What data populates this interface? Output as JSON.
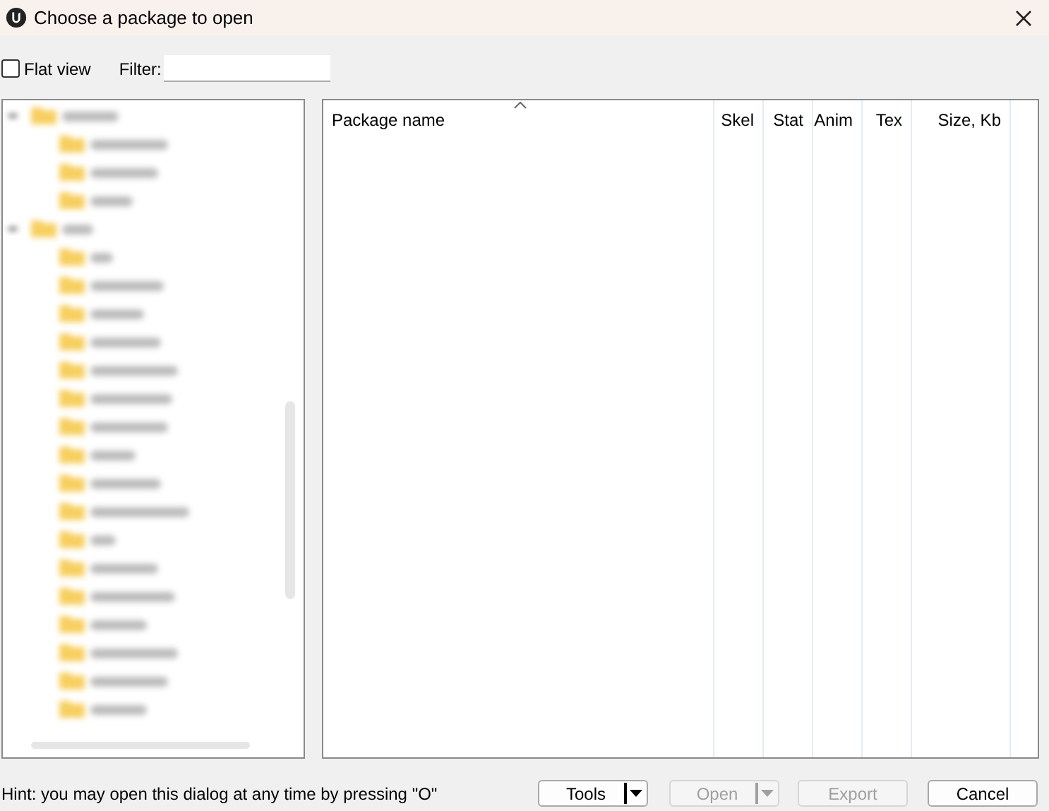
{
  "window": {
    "title": "Choose a package to open"
  },
  "flat_view": {
    "label": "Flat view",
    "checked": false
  },
  "filter": {
    "label": "Filter:"
  },
  "tree": [
    {
      "kind": "folder",
      "expanded": true,
      "children": [
        {
          "kind": "folder"
        },
        {
          "kind": "folder"
        },
        {
          "kind": "folder"
        }
      ]
    },
    {
      "kind": "folder",
      "expanded": true,
      "children": [
        {
          "kind": "folder"
        },
        {
          "kind": "folder"
        },
        {
          "kind": "folder"
        },
        {
          "kind": "folder"
        },
        {
          "kind": "folder"
        },
        {
          "kind": "folder"
        },
        {
          "kind": "folder"
        },
        {
          "kind": "folder"
        },
        {
          "kind": "folder"
        },
        {
          "kind": "folder"
        },
        {
          "kind": "folder"
        },
        {
          "kind": "folder"
        },
        {
          "kind": "folder"
        },
        {
          "kind": "folder"
        },
        {
          "kind": "folder"
        },
        {
          "kind": "folder"
        },
        {
          "kind": "folder"
        }
      ]
    }
  ],
  "table": {
    "columns": [
      {
        "label": "Package name",
        "sorted": true
      },
      {
        "label": "Skel",
        "sorted": false
      },
      {
        "label": "Stat",
        "sorted": false
      },
      {
        "label": "Anim",
        "sorted": false
      },
      {
        "label": "Tex",
        "sorted": false
      },
      {
        "label": "Size, Kb",
        "sorted": false
      }
    ]
  },
  "hint": "Hint: you may open this dialog at any time by pressing \"O\"",
  "buttons": [
    {
      "label": "Tools",
      "split": true,
      "disabled": false
    },
    {
      "label": "Open",
      "split": true,
      "disabled": true
    },
    {
      "label": "Export",
      "split": false,
      "disabled": true
    },
    {
      "label": "Cancel",
      "split": false,
      "disabled": false
    }
  ]
}
